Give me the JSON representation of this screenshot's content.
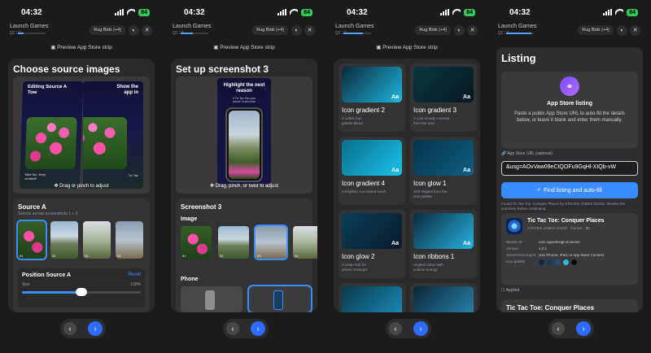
{
  "status": {
    "time": "04:32",
    "battery": "84"
  },
  "game_bar": {
    "title": "Launch Games",
    "sub": "Q1 / 2",
    "pill": "Rug Bids (+4)",
    "icon_a": "◐",
    "icon_b": "✕"
  },
  "preview_link": "Preview App Store strip",
  "nav": {
    "back": "‹",
    "next": "›"
  },
  "phone1": {
    "title": "Choose source images",
    "shot_left_text": "Editing Source A\nTow",
    "shot_right_text": "Show the\napp in",
    "small_left": "Take fun, keep\ncreative!",
    "small_right": "Tic Tac",
    "hint": "Drag or pinch to adjust",
    "source_title": "Source A",
    "source_sub": "Selects across screenshots 1 + 2",
    "thumbs": [
      "01",
      "02",
      "03",
      "04"
    ],
    "position_title": "Position Source A",
    "reset": "Reset",
    "size_label": "Size",
    "size_value": "100%",
    "size_fraction": 0.5
  },
  "phone2": {
    "title": "Set up screenshot 3",
    "headline": "Highlight the next\nreason",
    "subline": "# Tic Tac Toe your\nphone in seconds",
    "hint": "Drag, pinch, or twist to adjust",
    "section_title": "Screenshot 3",
    "image_label": "Image",
    "thumbs": [
      "01",
      "02",
      "03",
      "04"
    ],
    "phone_label": "Phone"
  },
  "phone3": {
    "cards": [
      {
        "name": "Icon gradient 2",
        "desc": "A softer icon\npalette blend",
        "aa": "Aa",
        "c1": "#0b2a3a",
        "c2": "#1fb5e0"
      },
      {
        "name": "Icon gradient 3",
        "desc": "A cool moody contrast\nfrom the icon",
        "aa": "Aa",
        "c1": "#0a3742",
        "c2": "#061820"
      },
      {
        "name": "Icon gradient 4",
        "desc": "A brighter, icon-tinted wash",
        "aa": "Aa",
        "c1": "#0a6d8c",
        "c2": "#19c3ea"
      },
      {
        "name": "Icon glow 1",
        "desc": "Soft shapes from the\nicon palette",
        "aa": "Aa",
        "c1": "#07334a",
        "c2": "#0d5f82"
      },
      {
        "name": "Icon glow 2",
        "desc": "A clean hub for\nphone mockups",
        "aa": "Aa",
        "c1": "#0a3f5a",
        "c2": "#0a1a2a"
      },
      {
        "name": "Icon ribbons 1",
        "desc": "Angled colour with\ncustom energy",
        "aa": "Aa",
        "c1": "#0a2a3a",
        "c2": "#26b3e0"
      },
      {
        "name": "",
        "desc": "",
        "aa": "",
        "c1": "#0a3a4a",
        "c2": "#1a8fbf"
      },
      {
        "name": "",
        "desc": "",
        "aa": "",
        "c1": "#0b2636",
        "c2": "#2a8ab5"
      }
    ]
  },
  "phone4": {
    "title": "Listing",
    "intro_title": "App Store listing",
    "intro_text": "Paste a public App Store URL to auto-fill the details below, or leave it blank and enter them manually.",
    "url_label": "App Store URL (optional)",
    "url_value": "&usg=AOvVaw09eCtQOFu9GqHl-XIQb-vW",
    "find_label": "Find listing and auto-fill",
    "found_text": "Found Tic Tac Toe: Conquer Places by STEVEN JAMES GOOD. Review the summary before continuing.",
    "app_name": "Tic Tac Toe: Conquer Places",
    "app_sub": "STEVEN JAMES GOOD · Games · $8",
    "rows": [
      {
        "k": "Bundle ID",
        "v": "com.vigordesign.tictactoe"
      },
      {
        "k": "Version",
        "v": "1.2.1"
      },
      {
        "k": "Screenshot import",
        "v": "Use iPhone, iPad, or App Store Connect"
      }
    ],
    "palette_label": "Icon palette",
    "palette": [
      "#0b2a4a",
      "#123a5c",
      "#1c4f7a",
      "#2fb8e6",
      "#0a0a0a"
    ],
    "applied": "Applied",
    "bottom_title": "Tic Tac Toe: Conquer Places"
  }
}
